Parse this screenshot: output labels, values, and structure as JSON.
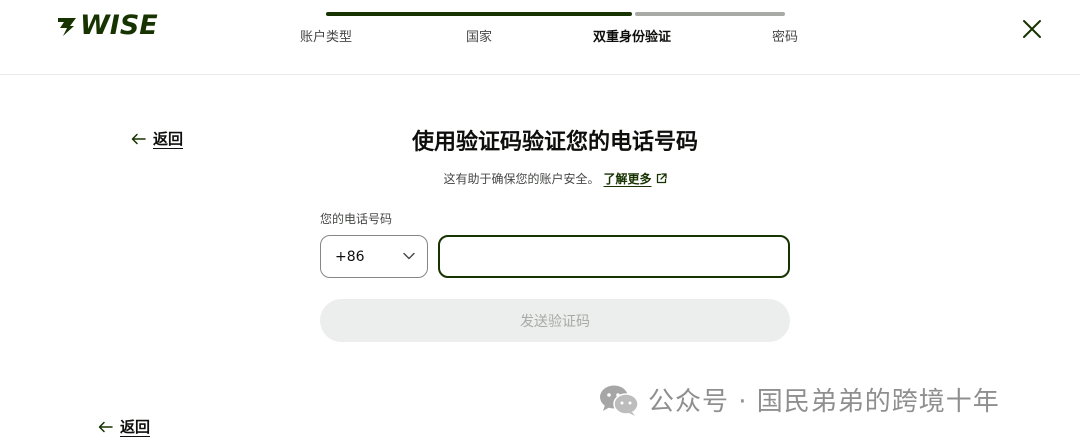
{
  "brand": {
    "name": "WISE",
    "color": "#163300"
  },
  "stepper": {
    "progress_done_fraction": 0.67,
    "steps": [
      {
        "label": "账户类型",
        "state": "done"
      },
      {
        "label": "国家",
        "state": "done"
      },
      {
        "label": "双重身份验证",
        "state": "active"
      },
      {
        "label": "密码",
        "state": "todo"
      }
    ]
  },
  "header": {
    "close_icon": "close-icon"
  },
  "nav": {
    "back_label": "返回",
    "back_label_bottom": "返回"
  },
  "main": {
    "title": "使用验证码验证您的电话号码",
    "subtitle": "这有助于确保您的账户安全。",
    "learn_more": "了解更多",
    "phone_label": "您的电话号码",
    "country_code": "+86",
    "phone_value": "",
    "send_button": "发送验证码"
  },
  "watermark": {
    "text": "公众号 · 国民弟弟的跨境十年"
  },
  "colors": {
    "accent": "#163300",
    "muted_text": "#454745",
    "disabled_bg": "#eceded",
    "disabled_text": "#a8aaa6"
  }
}
